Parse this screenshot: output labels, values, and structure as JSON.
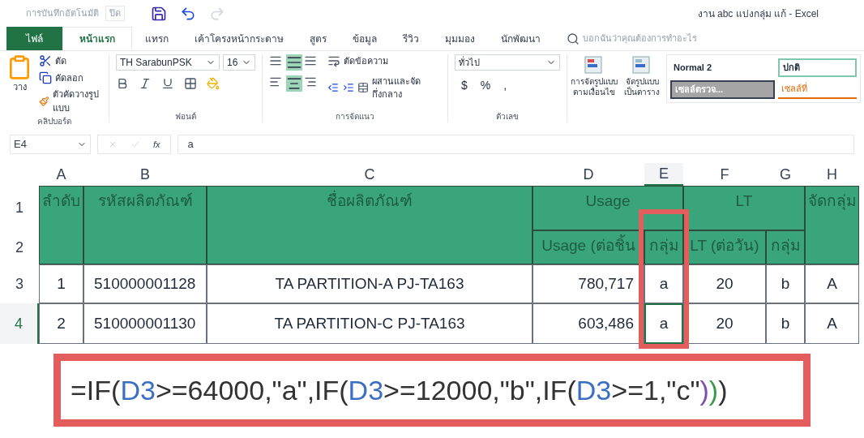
{
  "quick_access": {
    "autosave_label": "การบันทึกอัตโนมัติ",
    "autosave_toggle": "ปิด"
  },
  "window": {
    "title": "งาน abc แบ่งกลุ่ม แก้  -  Excel"
  },
  "tabs": [
    {
      "label": "ไฟล์",
      "kind": "file",
      "selected": false
    },
    {
      "label": "หน้าแรก",
      "kind": "tab",
      "selected": true
    },
    {
      "label": "แทรก",
      "kind": "tab",
      "selected": false
    },
    {
      "label": "เค้าโครงหน้ากระดาษ",
      "kind": "tab",
      "selected": false
    },
    {
      "label": "สูตร",
      "kind": "tab",
      "selected": false
    },
    {
      "label": "ข้อมูล",
      "kind": "tab",
      "selected": false
    },
    {
      "label": "รีวิว",
      "kind": "tab",
      "selected": false
    },
    {
      "label": "มุมมอง",
      "kind": "tab",
      "selected": false
    },
    {
      "label": "นักพัฒนา",
      "kind": "tab",
      "selected": false
    }
  ],
  "tell_me": {
    "placeholder": "บอกฉันว่าคุณต้องการทำอะไร"
  },
  "ribbon": {
    "clipboard": {
      "paste": "วาง",
      "cut": "ตัด",
      "copy": "คัดลอก",
      "format_painter": "ตัวคัดวางรูปแบบ",
      "group": "คลิปบอร์ด"
    },
    "font": {
      "name": "TH SarabunPSK",
      "size": "16",
      "group": "ฟอนต์"
    },
    "alignment": {
      "wrap": "ตัดข้อความ",
      "merge": "ผสานและจัดกึ่งกลาง",
      "group": "การจัดแนว"
    },
    "number": {
      "format": "ทั่วไป",
      "currency": "$",
      "percent": "%",
      "comma": ",",
      "group": "ตัวเลข"
    },
    "styles": {
      "conditional": [
        "การจัดรูปแบบ",
        "ตามเงื่อนไข"
      ],
      "as_table": [
        "จัดรูปแบบ",
        "เป็นตาราง"
      ],
      "cells": [
        {
          "label": "Normal 2",
          "kind": "normal"
        },
        {
          "label": "ปกติ",
          "kind": "good"
        },
        {
          "label": "เซลล์ตรวจ...",
          "kind": "check"
        },
        {
          "label": "เซลล์ที่",
          "kind": "linked"
        }
      ]
    }
  },
  "formula_bar": {
    "name_box": "E4",
    "function_label": "fx",
    "value": "a"
  },
  "table": {
    "columns": [
      {
        "label": "A",
        "selected": false
      },
      {
        "label": "B",
        "selected": false
      },
      {
        "label": "C",
        "selected": false
      },
      {
        "label": "D",
        "selected": false
      },
      {
        "label": "E",
        "selected": true
      },
      {
        "label": "F",
        "selected": false
      },
      {
        "label": "G",
        "selected": false
      },
      {
        "label": "H",
        "selected": false
      }
    ],
    "header_row_numbers": [
      "1",
      "2"
    ],
    "header_cells": [
      "ลำดับ",
      "รหัสผลิตภัณฑ์",
      "ชื่อผลิตภัณฑ์",
      "Usage",
      "LT",
      "จัดกลุ่ม",
      "Usage (ต่อชิ้น",
      "กลุ่ม",
      "LT (ต่อวัน)",
      "กลุ่ม"
    ],
    "rows": [
      {
        "number": "3",
        "selected": false,
        "cells": [
          "1",
          "510000001128",
          "TA PARTITION-A PJ-TA163",
          "780,717",
          "a",
          "20",
          "b",
          "A"
        ]
      },
      {
        "number": "4",
        "selected": true,
        "cells": [
          "2",
          "510000001130",
          "TA PARTITION-C PJ-TA163",
          "603,486",
          "a",
          "20",
          "b",
          "A"
        ]
      }
    ]
  },
  "formula_zoom": {
    "segments": [
      {
        "text": "=IF(",
        "color": "#333333"
      },
      {
        "text": "D3",
        "color": "#3b6fc4"
      },
      {
        "text": ">=64000,\"a\",IF(",
        "color": "#333333"
      },
      {
        "text": "D3",
        "color": "#3b6fc4"
      },
      {
        "text": ">=12000,\"b\",IF(",
        "color": "#333333"
      },
      {
        "text": "D3",
        "color": "#3b6fc4"
      },
      {
        "text": ">=1,\"c\"",
        "color": "#333333"
      },
      {
        "text": ")",
        "color": "#7a4fb0"
      },
      {
        "text": ")",
        "color": "#3a9a4a"
      },
      {
        "text": ")",
        "color": "#333333"
      }
    ]
  }
}
